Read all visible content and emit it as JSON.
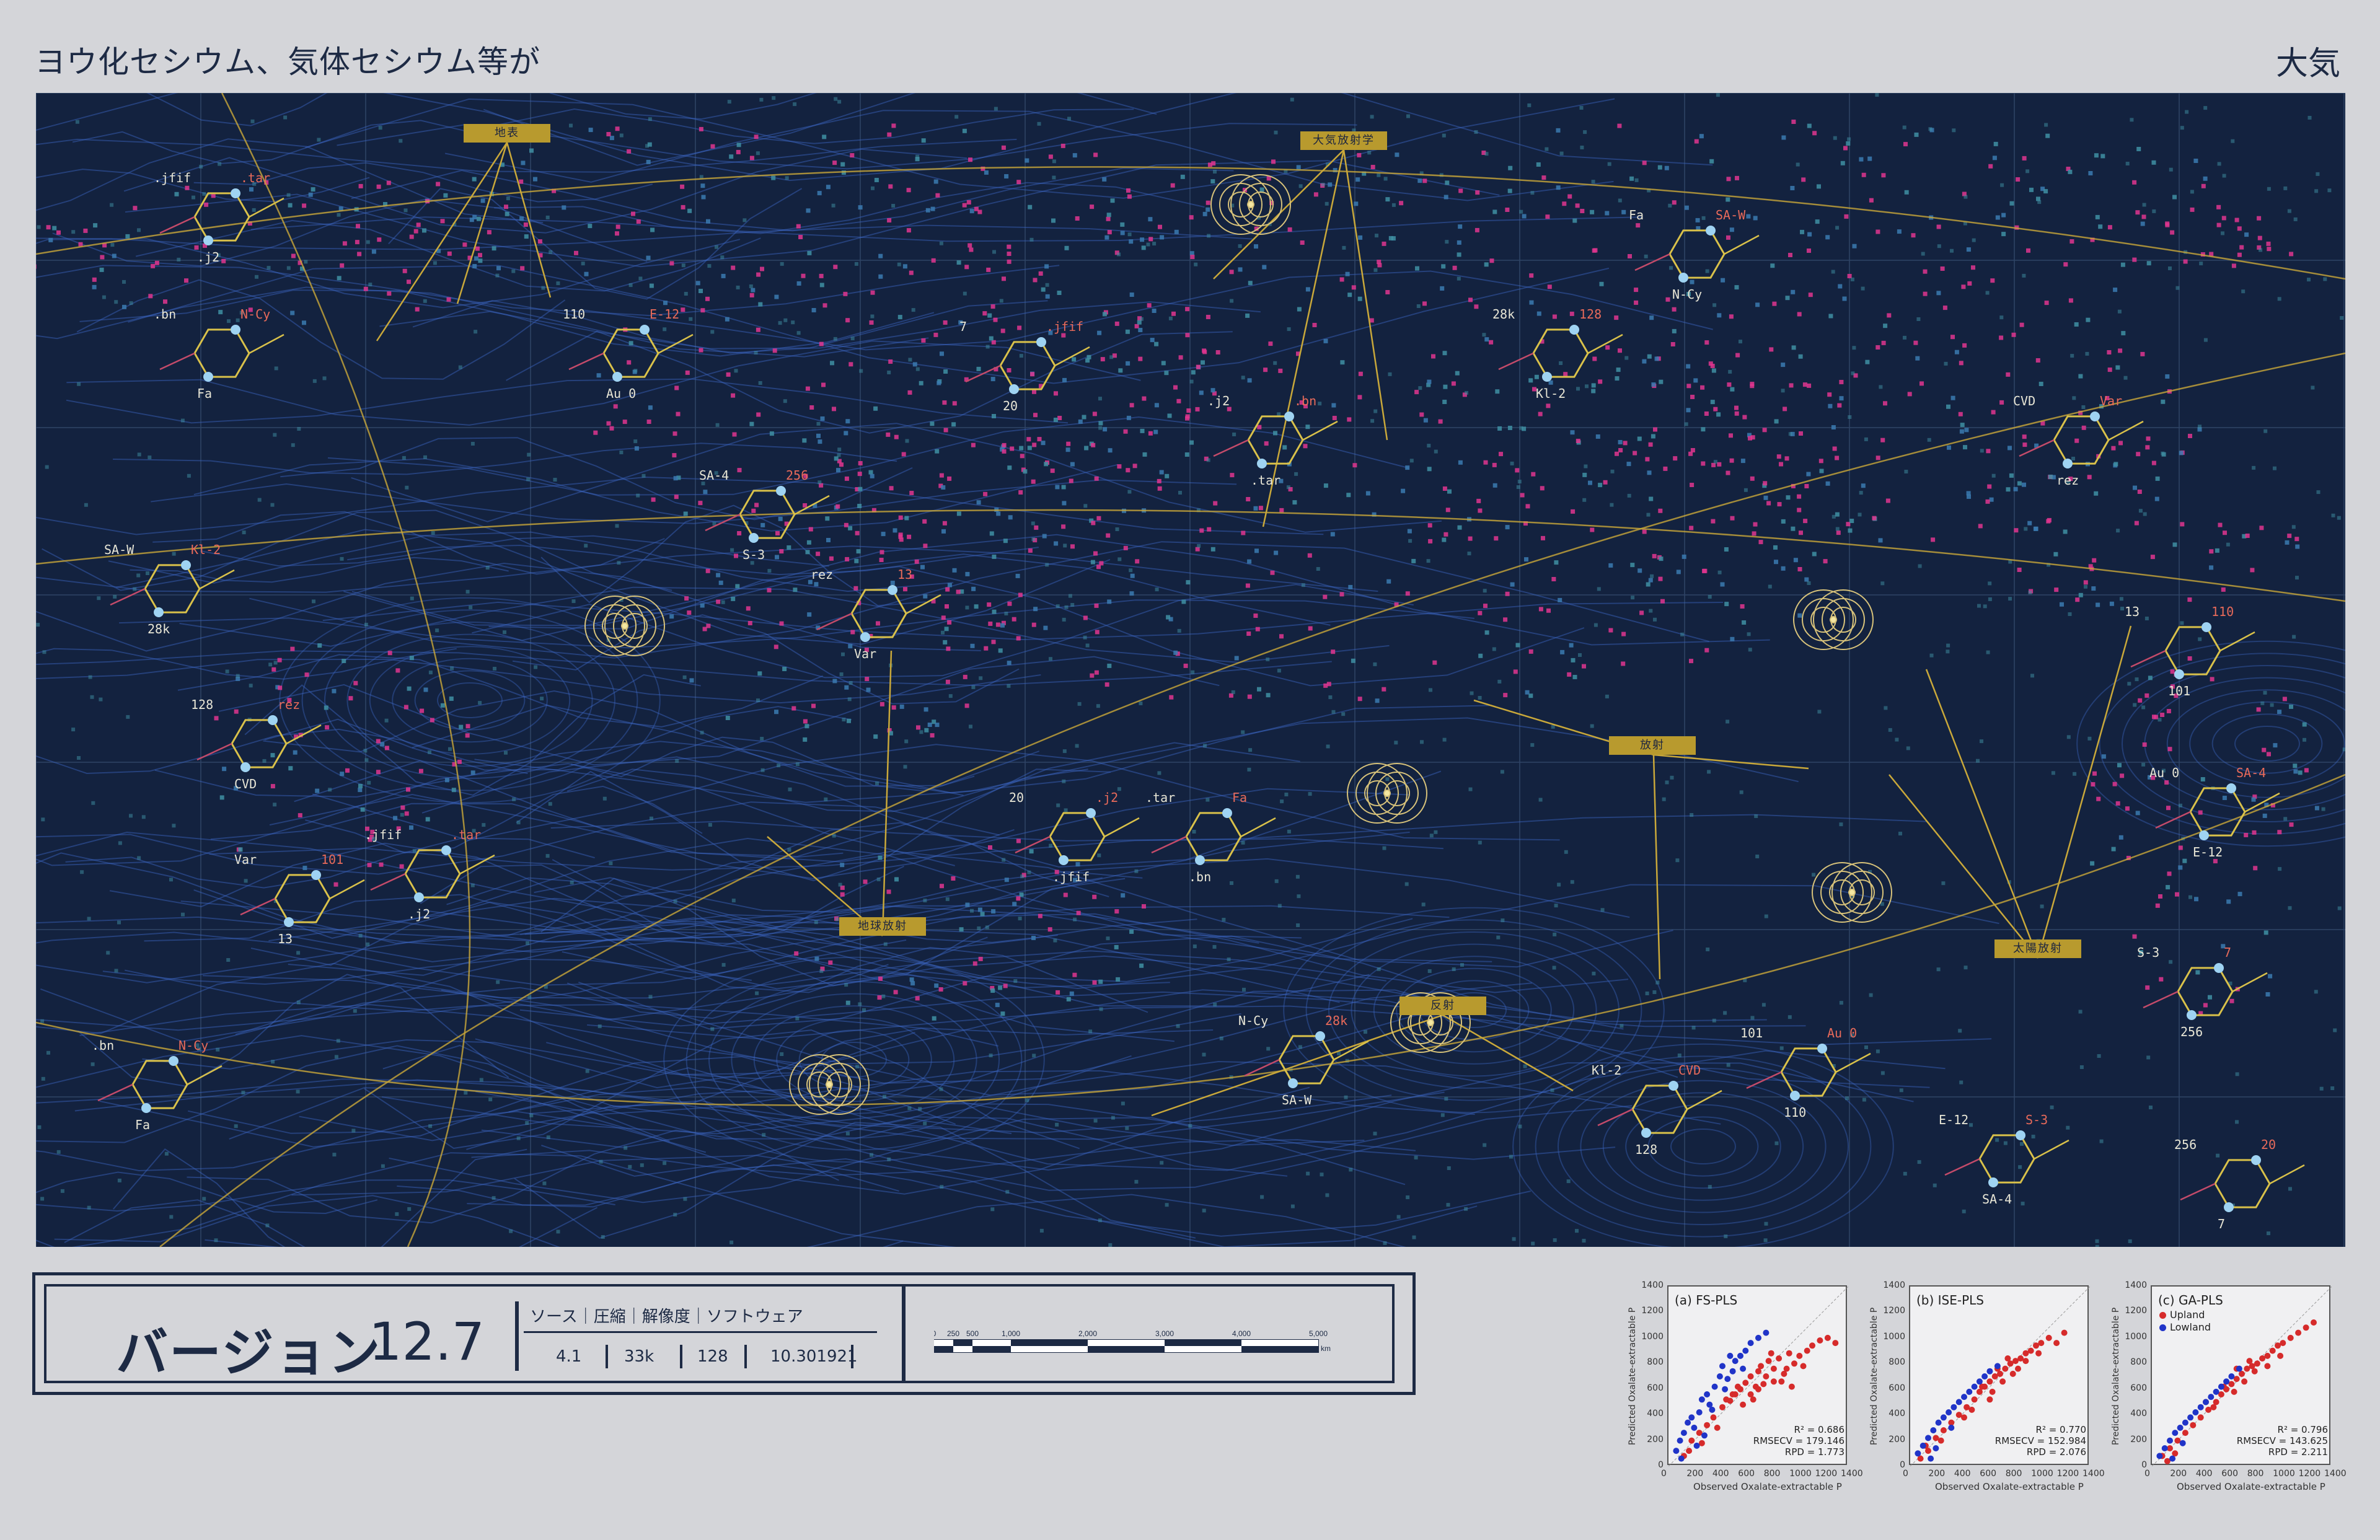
{
  "header": {
    "title": "ヨウ化セシウム、気体セシウム等が",
    "corner_label": "大気"
  },
  "map": {
    "labels": [
      "地表",
      "大気放射学",
      "放射",
      "地球放射",
      "太陽放射",
      "反射"
    ],
    "annotations": [
      ".jfif",
      ".j2",
      ".tar",
      ".bn",
      "Fa",
      "N-Cy",
      "SA-W",
      "28k",
      "Kl-2",
      "128",
      "CVD",
      "rez",
      "Var",
      "13",
      "101",
      "110",
      "Au 0",
      "E-12",
      "SA-4",
      "S-3",
      "256",
      "7",
      "20"
    ],
    "colors": {
      "background": "#13223f",
      "flow": "#3b66c4",
      "pink": "#e0358f",
      "teal": "#3f8fa3",
      "gold": "#c9a83a",
      "molecule": "#d9c14a"
    }
  },
  "info": {
    "version_label": "バージョン",
    "version_value": "12.7",
    "headers": "ソース｜圧縮｜解像度｜ソフトウェア",
    "values": [
      "4.1",
      "33k",
      "128",
      "10.301921"
    ],
    "scale": {
      "ticks": [
        "0",
        "250",
        "500",
        "1,000",
        "2,000",
        "3,000",
        "4,000",
        "5,000"
      ],
      "unit": "km"
    }
  },
  "chart_data": [
    {
      "type": "scatter",
      "title": "(a) FS-PLS",
      "xlabel": "Observed Oxalate-extractable P",
      "ylabel": "Predicted Oxalate-extractable P",
      "xlim": [
        0,
        1400
      ],
      "ylim": [
        0,
        1400
      ],
      "ticks": [
        "0",
        "200",
        "400",
        "600",
        "800",
        "1000",
        "1200",
        "1400"
      ],
      "stats": [
        "R² = 0.686",
        "RMSECV = 179.146",
        "RPD = 1.773"
      ],
      "series": [
        {
          "color": "#d62b2b",
          "values": [
            [
              120,
              80
            ],
            [
              180,
              200
            ],
            [
              240,
              260
            ],
            [
              300,
              320
            ],
            [
              350,
              380
            ],
            [
              420,
              460
            ],
            [
              480,
              510
            ],
            [
              520,
              560
            ],
            [
              560,
              600
            ],
            [
              600,
              650
            ],
            [
              640,
              700
            ],
            [
              680,
              620
            ],
            [
              700,
              740
            ],
            [
              720,
              780
            ],
            [
              760,
              700
            ],
            [
              780,
              820
            ],
            [
              820,
              760
            ],
            [
              860,
              840
            ],
            [
              900,
              720
            ],
            [
              940,
              880
            ],
            [
              980,
              800
            ],
            [
              1020,
              860
            ],
            [
              1080,
              900
            ],
            [
              1120,
              940
            ],
            [
              1180,
              980
            ],
            [
              1240,
              1000
            ],
            [
              1300,
              960
            ],
            [
              660,
              520
            ],
            [
              580,
              480
            ],
            [
              500,
              560
            ],
            [
              740,
              640
            ],
            [
              880,
              660
            ],
            [
              960,
              620
            ],
            [
              640,
              560
            ],
            [
              700,
              600
            ],
            [
              820,
              660
            ],
            [
              540,
              620
            ],
            [
              450,
              520
            ],
            [
              380,
              300
            ],
            [
              260,
              180
            ],
            [
              160,
              120
            ],
            [
              800,
              880
            ],
            [
              920,
              760
            ],
            [
              1050,
              780
            ]
          ]
        },
        {
          "color": "#2034c8",
          "values": [
            [
              60,
              120
            ],
            [
              90,
              200
            ],
            [
              120,
              260
            ],
            [
              150,
              340
            ],
            [
              180,
              380
            ],
            [
              200,
              300
            ],
            [
              240,
              420
            ],
            [
              260,
              520
            ],
            [
              300,
              560
            ],
            [
              320,
              480
            ],
            [
              360,
              620
            ],
            [
              400,
              700
            ],
            [
              420,
              780
            ],
            [
              460,
              680
            ],
            [
              500,
              740
            ],
            [
              520,
              820
            ],
            [
              560,
              860
            ],
            [
              600,
              900
            ],
            [
              640,
              960
            ],
            [
              700,
              1000
            ],
            [
              760,
              1040
            ],
            [
              340,
              440
            ],
            [
              280,
              240
            ],
            [
              220,
              160
            ],
            [
              100,
              60
            ],
            [
              440,
              600
            ],
            [
              480,
              860
            ],
            [
              580,
              760
            ]
          ]
        }
      ]
    },
    {
      "type": "scatter",
      "title": "(b) ISE-PLS",
      "xlabel": "Observed Oxalate-extractable P",
      "ylabel": "Predicted Oxalate-extractable P",
      "xlim": [
        0,
        1400
      ],
      "ylim": [
        0,
        1400
      ],
      "ticks": [
        "0",
        "200",
        "400",
        "600",
        "800",
        "1000",
        "1200",
        "1400"
      ],
      "stats": [
        "R² = 0.770",
        "RMSECV = 152.984",
        "RPD = 2.076"
      ],
      "series": [
        {
          "color": "#d62b2b",
          "values": [
            [
              80,
              60
            ],
            [
              140,
              120
            ],
            [
              200,
              220
            ],
            [
              260,
              280
            ],
            [
              320,
              340
            ],
            [
              380,
              400
            ],
            [
              440,
              460
            ],
            [
              500,
              520
            ],
            [
              540,
              580
            ],
            [
              580,
              620
            ],
            [
              620,
              660
            ],
            [
              660,
              700
            ],
            [
              700,
              720
            ],
            [
              740,
              760
            ],
            [
              780,
              800
            ],
            [
              820,
              820
            ],
            [
              860,
              840
            ],
            [
              900,
              880
            ],
            [
              940,
              900
            ],
            [
              980,
              940
            ],
            [
              1020,
              960
            ],
            [
              1080,
              1000
            ],
            [
              1140,
              960
            ],
            [
              1200,
              1040
            ],
            [
              640,
              580
            ],
            [
              720,
              660
            ],
            [
              800,
              720
            ],
            [
              560,
              620
            ],
            [
              480,
              440
            ],
            [
              420,
              380
            ],
            [
              760,
              840
            ],
            [
              840,
              760
            ],
            [
              680,
              760
            ],
            [
              620,
              520
            ],
            [
              900,
              820
            ],
            [
              1000,
              880
            ],
            [
              120,
              160
            ],
            [
              240,
              200
            ]
          ]
        },
        {
          "color": "#2034c8",
          "values": [
            [
              60,
              100
            ],
            [
              100,
              160
            ],
            [
              140,
              220
            ],
            [
              180,
              280
            ],
            [
              220,
              340
            ],
            [
              260,
              380
            ],
            [
              300,
              420
            ],
            [
              340,
              460
            ],
            [
              380,
              500
            ],
            [
              420,
              540
            ],
            [
              460,
              580
            ],
            [
              500,
              620
            ],
            [
              540,
              660
            ],
            [
              580,
              700
            ],
            [
              620,
              740
            ],
            [
              680,
              780
            ],
            [
              200,
              140
            ],
            [
              320,
              300
            ],
            [
              160,
              60
            ]
          ]
        }
      ]
    },
    {
      "type": "scatter",
      "title": "(c) GA-PLS",
      "xlabel": "Observed Oxalate-extractable P",
      "ylabel": "Predicted Oxalate-extractable P",
      "xlim": [
        0,
        1400
      ],
      "ylim": [
        0,
        1400
      ],
      "ticks": [
        "0",
        "200",
        "400",
        "600",
        "800",
        "1000",
        "1200",
        "1400"
      ],
      "legend": [
        "Upland",
        "Lowland"
      ],
      "stats": [
        "R² = 0.796",
        "RMSECV = 143.625",
        "RPD = 2.211"
      ],
      "series": [
        {
          "name": "Upland",
          "color": "#d62b2b",
          "values": [
            [
              80,
              80
            ],
            [
              140,
              140
            ],
            [
              200,
              200
            ],
            [
              260,
              260
            ],
            [
              320,
              320
            ],
            [
              380,
              380
            ],
            [
              440,
              440
            ],
            [
              500,
              500
            ],
            [
              540,
              560
            ],
            [
              580,
              600
            ],
            [
              620,
              640
            ],
            [
              660,
              680
            ],
            [
              700,
              720
            ],
            [
              740,
              760
            ],
            [
              780,
              780
            ],
            [
              820,
              800
            ],
            [
              860,
              840
            ],
            [
              900,
              860
            ],
            [
              940,
              900
            ],
            [
              980,
              940
            ],
            [
              1020,
              960
            ],
            [
              1080,
              1000
            ],
            [
              1140,
              1040
            ],
            [
              1200,
              1080
            ],
            [
              1260,
              1120
            ],
            [
              640,
              580
            ],
            [
              720,
              660
            ],
            [
              800,
              740
            ],
            [
              560,
              620
            ],
            [
              480,
              460
            ],
            [
              900,
              780
            ],
            [
              1000,
              860
            ],
            [
              660,
              760
            ],
            [
              760,
              820
            ],
            [
              420,
              500
            ],
            [
              120,
              40
            ],
            [
              180,
              100
            ]
          ]
        },
        {
          "name": "Lowland",
          "color": "#2034c8",
          "values": [
            [
              60,
              80
            ],
            [
              100,
              140
            ],
            [
              140,
              200
            ],
            [
              180,
              260
            ],
            [
              220,
              300
            ],
            [
              260,
              340
            ],
            [
              300,
              380
            ],
            [
              340,
              420
            ],
            [
              380,
              460
            ],
            [
              420,
              500
            ],
            [
              460,
              540
            ],
            [
              500,
              580
            ],
            [
              540,
              620
            ],
            [
              580,
              660
            ],
            [
              620,
              700
            ],
            [
              680,
              760
            ],
            [
              240,
              180
            ],
            [
              160,
              60
            ]
          ]
        }
      ]
    }
  ]
}
